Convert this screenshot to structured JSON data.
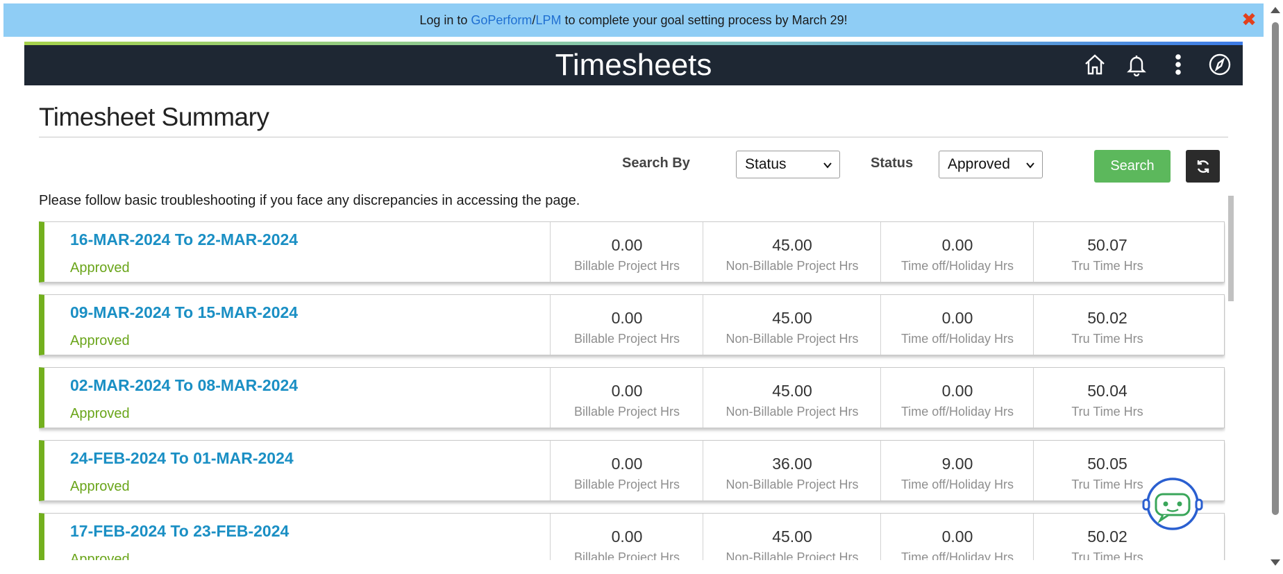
{
  "banner": {
    "text_before": "Log in to ",
    "link1": "GoPerform",
    "separator": " / ",
    "link2": "LPM",
    "text_after": " to complete your goal setting process by March 29!",
    "close_symbol": "✖"
  },
  "header": {
    "title": "Timesheets",
    "icons": [
      "home-icon",
      "bell-icon",
      "more-vertical-icon",
      "compass-icon"
    ]
  },
  "page": {
    "title": "Timesheet Summary",
    "note": "Please follow basic troubleshooting if you face any discrepancies in accessing the page."
  },
  "search": {
    "search_by_label": "Search By",
    "search_by_value": "Status",
    "status_label": "Status",
    "status_value": "Approved",
    "search_button": "Search"
  },
  "captions": {
    "billable": "Billable Project Hrs",
    "non_billable": "Non-Billable Project Hrs",
    "time_off": "Time off/Holiday Hrs",
    "tru_time": "Tru Time Hrs"
  },
  "timesheets": [
    {
      "period": "16-MAR-2024 To 22-MAR-2024",
      "status": "Approved",
      "billable": "0.00",
      "non_billable": "45.00",
      "time_off": "0.00",
      "tru_time": "50.07"
    },
    {
      "period": "09-MAR-2024 To 15-MAR-2024",
      "status": "Approved",
      "billable": "0.00",
      "non_billable": "45.00",
      "time_off": "0.00",
      "tru_time": "50.02"
    },
    {
      "period": "02-MAR-2024 To 08-MAR-2024",
      "status": "Approved",
      "billable": "0.00",
      "non_billable": "45.00",
      "time_off": "0.00",
      "tru_time": "50.04"
    },
    {
      "period": "24-FEB-2024 To 01-MAR-2024",
      "status": "Approved",
      "billable": "0.00",
      "non_billable": "36.00",
      "time_off": "9.00",
      "tru_time": "50.05"
    },
    {
      "period": "17-FEB-2024 To 23-FEB-2024",
      "status": "Approved",
      "billable": "0.00",
      "non_billable": "45.00",
      "time_off": "0.00",
      "tru_time": "50.02"
    }
  ],
  "colors": {
    "banner_bg": "#8fcdf5",
    "header_bg": "#1e2733",
    "period_link": "#1a8fc4",
    "approved": "#6aa51a",
    "row_accent": "#73b01e",
    "search_button": "#5cb85c"
  }
}
